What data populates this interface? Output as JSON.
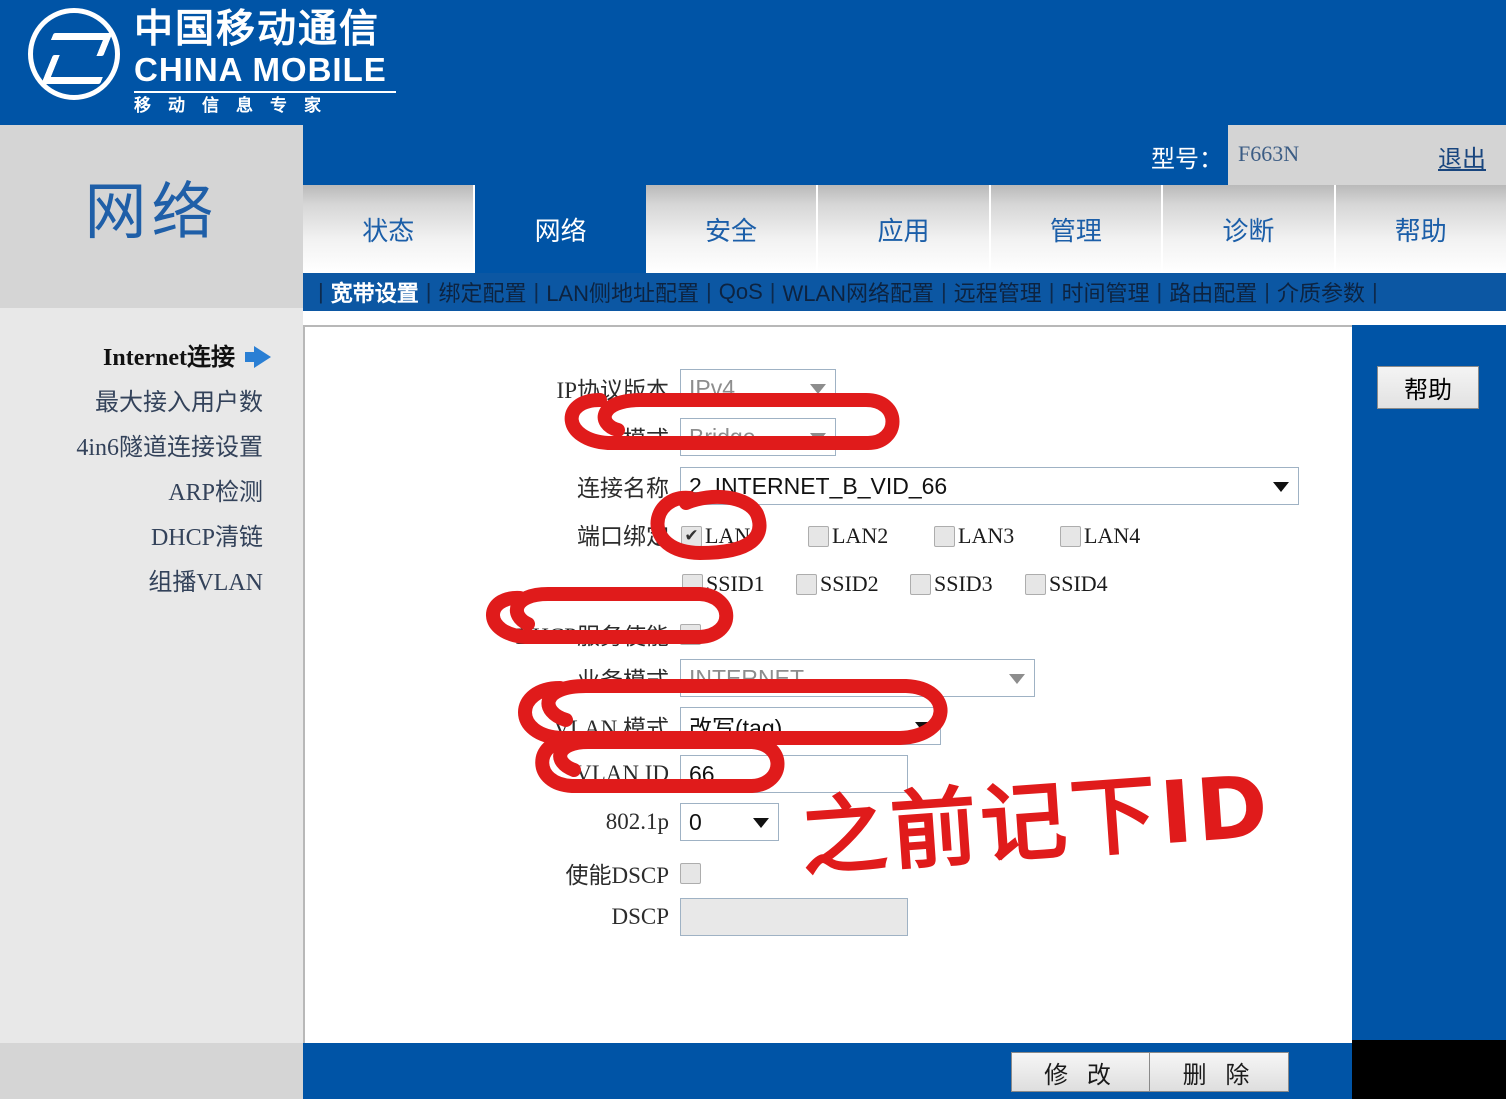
{
  "brand": {
    "logo_cn": "中国移动通信",
    "logo_en": "CHINA MOBILE",
    "slogan": "移动信息专家"
  },
  "header": {
    "model_label": "型号：",
    "model_value": "F663N",
    "logout": "退出"
  },
  "sidebar": {
    "title": "网络",
    "items": [
      {
        "label": "Internet连接",
        "active": true
      },
      {
        "label": "最大接入用户数",
        "active": false
      },
      {
        "label": "4in6隧道连接设置",
        "active": false
      },
      {
        "label": "ARP检测",
        "active": false
      },
      {
        "label": "DHCP清链",
        "active": false
      },
      {
        "label": "组播VLAN",
        "active": false
      }
    ]
  },
  "tabs": [
    {
      "label": "状态",
      "active": false
    },
    {
      "label": "网络",
      "active": true
    },
    {
      "label": "安全",
      "active": false
    },
    {
      "label": "应用",
      "active": false
    },
    {
      "label": "管理",
      "active": false
    },
    {
      "label": "诊断",
      "active": false
    },
    {
      "label": "帮助",
      "active": false
    }
  ],
  "subnav": {
    "separator": "|",
    "items": [
      {
        "label": "宽带设置",
        "active": true
      },
      {
        "label": "绑定配置",
        "active": false
      },
      {
        "label": "LAN侧地址配置",
        "active": false
      },
      {
        "label": "QoS",
        "active": false
      },
      {
        "label": "WLAN网络配置",
        "active": false
      },
      {
        "label": "远程管理",
        "active": false
      },
      {
        "label": "时间管理",
        "active": false
      },
      {
        "label": "路由配置",
        "active": false
      },
      {
        "label": "介质参数",
        "active": false
      }
    ]
  },
  "form": {
    "ip_version": {
      "label": "IP协议版本",
      "value": "IPv4",
      "disabled": true
    },
    "mode": {
      "label": "模式",
      "value": "Bridge",
      "disabled": true
    },
    "connection_name": {
      "label": "连接名称",
      "value": "2_INTERNET_B_VID_66",
      "disabled": false
    },
    "port_binding": {
      "label": "端口绑定",
      "lan": [
        {
          "label": "LAN1",
          "checked": true
        },
        {
          "label": "LAN2",
          "checked": false
        },
        {
          "label": "LAN3",
          "checked": false
        },
        {
          "label": "LAN4",
          "checked": false
        }
      ],
      "ssid": [
        {
          "label": "SSID1",
          "checked": false
        },
        {
          "label": "SSID2",
          "checked": false
        },
        {
          "label": "SSID3",
          "checked": false
        },
        {
          "label": "SSID4",
          "checked": false
        }
      ]
    },
    "dhcp_enable": {
      "label": "DHCP服务使能",
      "checked": false
    },
    "service_mode": {
      "label": "业务模式",
      "value": "INTERNET",
      "disabled": true
    },
    "vlan_mode": {
      "label": "VLAN 模式",
      "value": "改写(tag)",
      "disabled": false
    },
    "vlan_id": {
      "label": "VLAN ID",
      "value": "66",
      "disabled": false
    },
    "dot1p": {
      "label": "802.1p",
      "value": "0",
      "disabled": false
    },
    "dscp_enable": {
      "label": "使能DSCP",
      "checked": false
    },
    "dscp": {
      "label": "DSCP",
      "value": "",
      "disabled": true
    }
  },
  "help": {
    "button_label": "帮助"
  },
  "footer": {
    "modify_label": "修 改",
    "delete_label": "删 除"
  },
  "annotation": {
    "handwriting": "之前记下ID",
    "color": "#e01b1b"
  },
  "colors": {
    "brand_blue": "#0054a6",
    "subnav_blue": "#0c57a3",
    "sidebar_gray": "#d5d5d5",
    "menu_gray": "#e8e8e8",
    "annotation_red": "#e01b1b"
  }
}
